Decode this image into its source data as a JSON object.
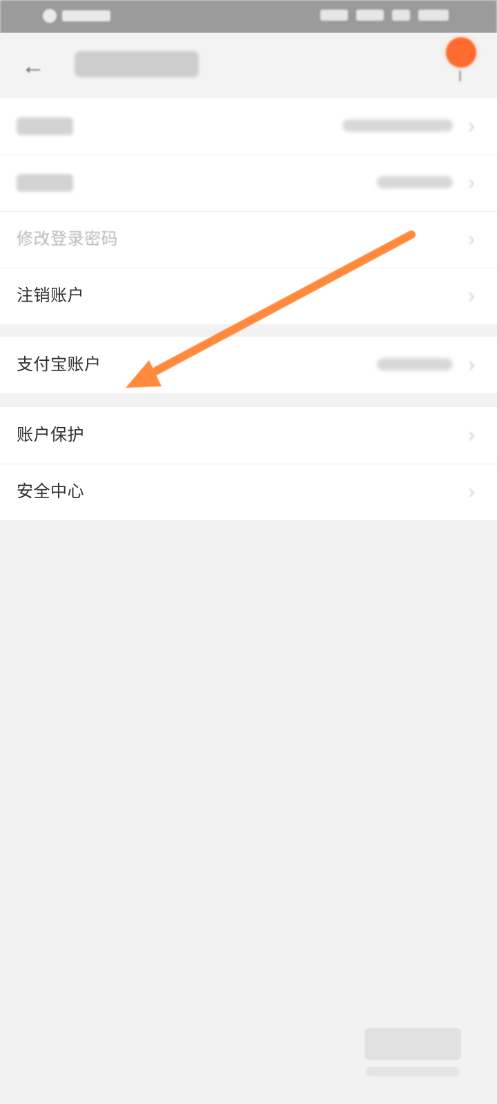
{
  "header": {
    "back_icon": "arrow-left-icon",
    "notify_color": "#ff6a2e"
  },
  "sections": [
    {
      "rows": [
        {
          "label_text": "",
          "label_visible": false,
          "value_visible": true
        },
        {
          "label_text": "",
          "label_visible": false,
          "value_visible": true
        },
        {
          "label_text": "修改登录密码",
          "label_visible": true,
          "muted": true
        },
        {
          "label_text": "注销账户",
          "label_visible": true,
          "muted": false
        }
      ]
    },
    {
      "rows": [
        {
          "label_text": "支付宝账户",
          "label_visible": true,
          "muted": false
        }
      ]
    },
    {
      "rows": [
        {
          "label_text": "账户保护",
          "label_visible": true,
          "muted": false
        },
        {
          "label_text": "安全中心",
          "label_visible": true,
          "muted": false
        }
      ]
    }
  ],
  "colors": {
    "background": "#f2f2f2",
    "row_background": "#ffffff",
    "text": "#2f2f2f",
    "muted_text": "#b8b8b8",
    "annotation_arrow": "#ff8a3d"
  }
}
